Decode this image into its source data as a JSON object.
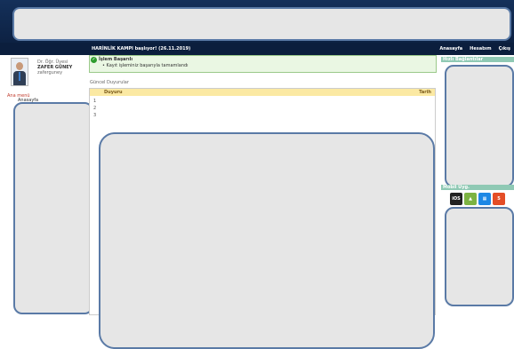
{
  "header": {
    "notice": "HARİNLİK KAMPI başlıyor! (26.11.2019)",
    "nav": [
      "Anasayfa",
      "Hesabım",
      "Çıkış"
    ]
  },
  "profile": {
    "title": "Dr. Öğr. Üyesi",
    "name": "ZAFER GÜNEY",
    "username": "zaferguney"
  },
  "menu": {
    "title": "Ana menü",
    "first_item": "Anasayfa"
  },
  "success": {
    "title": "İşlem Başarılı",
    "message": "Kayıt işleminiz başarıyla tamamlandı"
  },
  "announcements": {
    "title": "Güncel Duyurular",
    "columns": [
      "Duyuru",
      "Tarih"
    ],
    "rows": [
      "1",
      "2",
      "3"
    ]
  },
  "right": {
    "quick_links": "Hızlı Bağlantılar",
    "mobile": "Mobil Uyg."
  },
  "apps": [
    {
      "name": "ios-icon",
      "label": "iOS",
      "color": "#222222"
    },
    {
      "name": "android-icon",
      "label": "▲",
      "color": "#7cb342"
    },
    {
      "name": "windows-icon",
      "label": "▦",
      "color": "#1e88e5"
    },
    {
      "name": "html5-icon",
      "label": "5",
      "color": "#e44d26"
    }
  ]
}
